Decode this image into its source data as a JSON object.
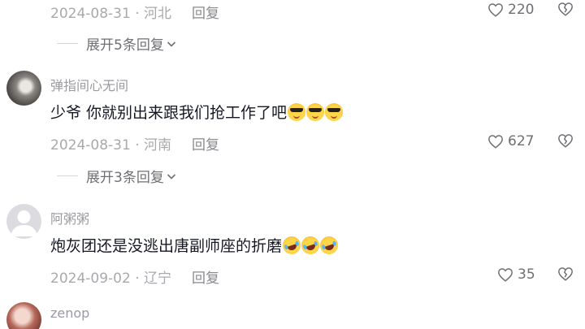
{
  "comments": [
    {
      "date": "2024-08-31",
      "separator": "·",
      "region": "河北",
      "reply_label": "回复",
      "likes": "220",
      "expand_label": "展开5条回复"
    },
    {
      "username": "弹指间心无间",
      "content": "少爷  你就别出来跟我们抢工作了吧",
      "emoji": [
        "sunglasses-emoji",
        "sunglasses-emoji",
        "sunglasses-emoji"
      ],
      "date": "2024-08-31",
      "separator": "·",
      "region": "河南",
      "reply_label": "回复",
      "likes": "627",
      "expand_label": "展开3条回复"
    },
    {
      "username": "阿粥粥",
      "content": "炮灰团还是没逃出唐副师座的折磨",
      "emoji": [
        "rolling-laughing-emoji",
        "rolling-laughing-emoji",
        "rolling-laughing-emoji"
      ],
      "date": "2024-09-02",
      "separator": "·",
      "region": "辽宁",
      "reply_label": "回复",
      "likes": "35"
    },
    {
      "username": "zenop"
    }
  ],
  "icons": {
    "like": "heart-outline-icon",
    "dislike": "broken-heart-icon",
    "expand": "chevron-down-icon"
  },
  "colors": {
    "text": "#161823",
    "meta": "#a9a9ad",
    "secondary": "#6f6f74"
  }
}
